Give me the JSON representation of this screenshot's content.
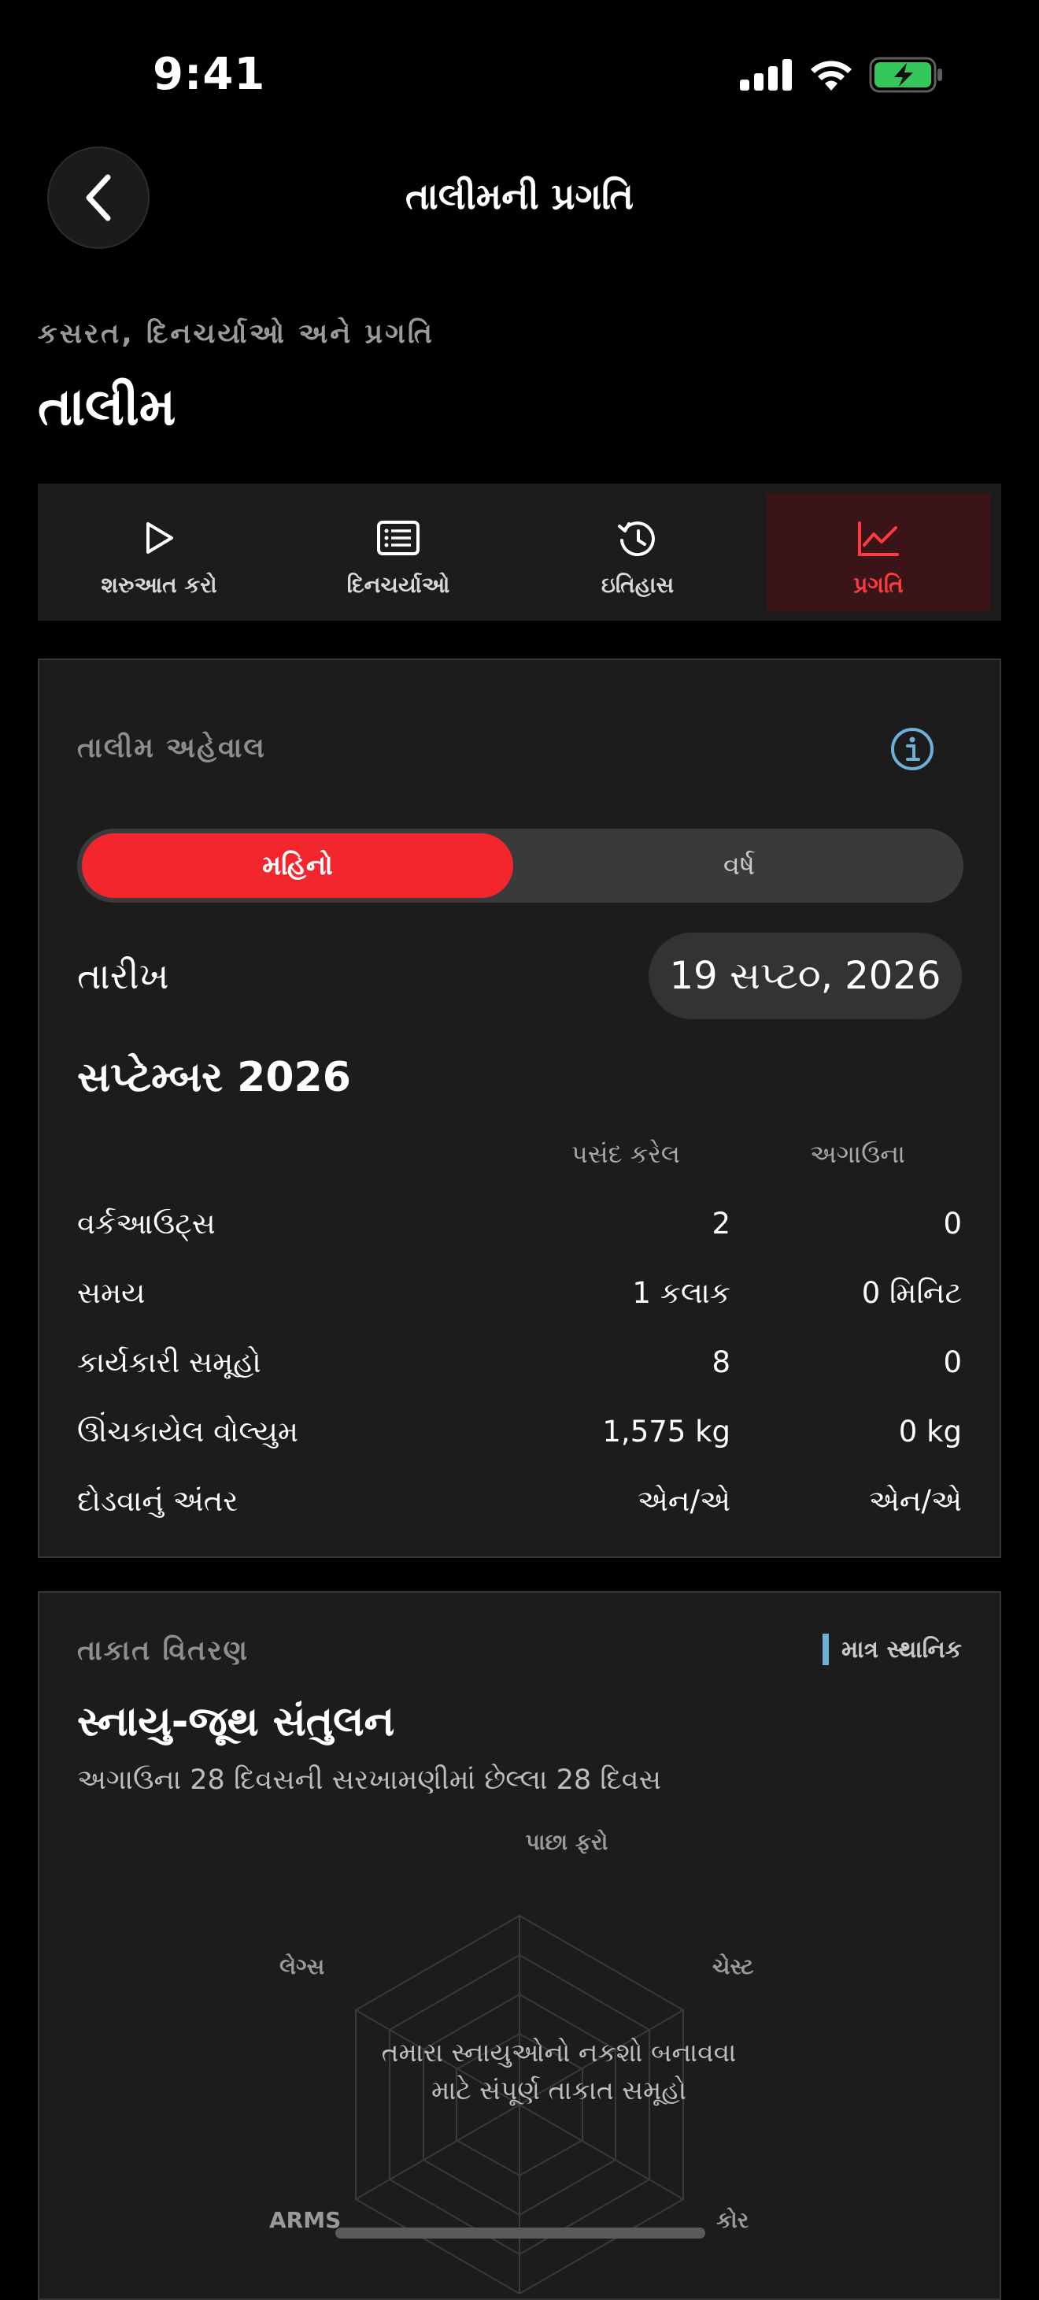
{
  "status_bar": {
    "time": "9:41"
  },
  "header": {
    "title": "તાલીમની પ્રગતિ"
  },
  "page": {
    "subtitle": "કસરત, દિનચર્યાઓ અને પ્રગતિ",
    "title": "તાલીમ"
  },
  "tabs": [
    {
      "label": "શરુઆત કરો",
      "icon": "play-icon",
      "active": false
    },
    {
      "label": "દિનચર્યાઓ",
      "icon": "list-icon",
      "active": false
    },
    {
      "label": "ઇતિહાસ",
      "icon": "history-icon",
      "active": false
    },
    {
      "label": "પ્રગતિ",
      "icon": "chart-line-icon",
      "active": true
    }
  ],
  "report": {
    "label": "તાલીમ અહેવાલ",
    "segments": {
      "month": "મહિનો",
      "year": "વર્ષ",
      "selected": "month"
    },
    "date_label": "તારીખ",
    "date_value": "19 સપ્ટ૦, 2026",
    "month_title": "સપ્ટેમ્બર 2026",
    "columns": {
      "selected": "પસંદ કરેલ",
      "previous": "અગાઉના"
    },
    "rows": [
      {
        "label": "વર્કઆઉટ્સ",
        "selected": "2",
        "previous": "0"
      },
      {
        "label": "સમય",
        "selected": "1 કલાક",
        "previous": "0 મિનિટ"
      },
      {
        "label": "કાર્યકારી સમૂહો",
        "selected": "8",
        "previous": "0"
      },
      {
        "label": "ઊંચકાયેલ વોલ્યુમ",
        "selected": "1,575 kg",
        "previous": "0 kg"
      },
      {
        "label": "દોડવાનું અંતર",
        "selected": "એન/એ",
        "previous": "એન/એ"
      }
    ]
  },
  "strength": {
    "label": "તાકાત વિતરણ",
    "badge": "માત્ર સ્થાનિક",
    "title": "સ્નાયુ-જૂથ સંતુલન",
    "subtitle": "અગાઉના 28 દિવસની સરખામણીમાં છેલ્લા 28 દિવસ",
    "axes": {
      "top": "પાછા ફરો",
      "top_right": "ચેસ્ટ",
      "bottom_right": "કોર",
      "top_left": "લેગ્સ",
      "bottom_left": "ARMS"
    },
    "message": "તમારા સ્નાયુઓનો નકશો બનાવવા માટે સંપૂર્ણ તાકાત સમૂહો"
  },
  "colors": {
    "accent": "#f3262e",
    "tab_active_bg": "#3a1416",
    "info": "#6fb0d8",
    "battery": "#34c759"
  }
}
